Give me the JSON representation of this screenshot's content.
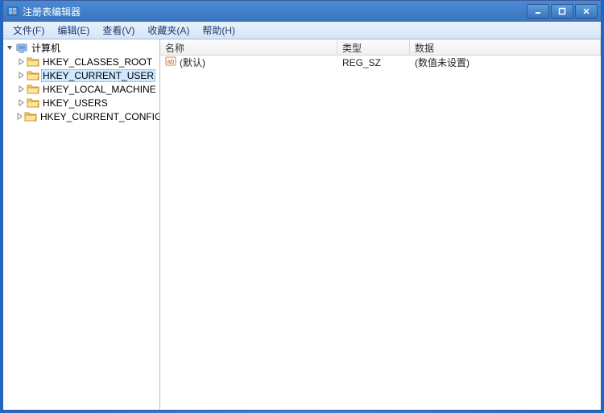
{
  "window": {
    "title": "注册表编辑器"
  },
  "menu": {
    "file": "文件(F)",
    "edit": "编辑(E)",
    "view": "查看(V)",
    "favorites": "收藏夹(A)",
    "help": "帮助(H)"
  },
  "tree": {
    "root": "计算机",
    "items": [
      {
        "label": "HKEY_CLASSES_ROOT"
      },
      {
        "label": "HKEY_CURRENT_USER"
      },
      {
        "label": "HKEY_LOCAL_MACHINE"
      },
      {
        "label": "HKEY_USERS"
      },
      {
        "label": "HKEY_CURRENT_CONFIG"
      }
    ],
    "selected_index": 1
  },
  "columns": {
    "name": "名称",
    "type": "类型",
    "data": "数据"
  },
  "rows": [
    {
      "name": "(默认)",
      "type": "REG_SZ",
      "data": "(数值未设置)"
    }
  ]
}
